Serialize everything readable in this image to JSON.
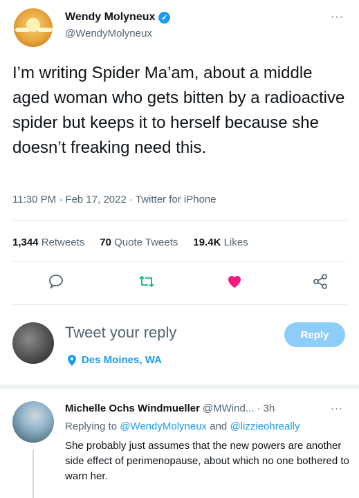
{
  "tweet": {
    "author_name": "Wendy Molyneux",
    "author_handle": "@WendyMolyneux",
    "more": "···",
    "text": "I’m writing Spider Ma’am, about a middle aged woman who gets bitten by a radioactive spider but keeps it to herself because she doesn’t freaking need this.",
    "meta": "11:30 PM · Feb 17, 2022 · Twitter for iPhone",
    "retweets_count": "1,344",
    "retweets_label": "Retweets",
    "quotes_count": "70",
    "quotes_label": "Quote Tweets",
    "likes_count": "19.4K",
    "likes_label": "Likes",
    "icons": [
      "comment-icon",
      "retweet-icon",
      "heart-icon",
      "share-icon"
    ]
  },
  "reply_box": {
    "placeholder": "Tweet your reply",
    "button_label": "Reply",
    "location": "Des Moines, WA"
  },
  "comment": {
    "name": "Michelle Ochs Windmueller",
    "handle": "@MWind...",
    "time": "· 3h",
    "more": "···",
    "replying_prefix": "Replying to",
    "replying_to_1": "@WendyMolyneux",
    "replying_and": "and",
    "replying_to_2": "@lizzieohreally",
    "text": "She probably just assumes that the new powers are another side effect of perimenopause, about which no one bothered to warn her."
  },
  "colors": {
    "accent": "#1d9bf0",
    "like": "#f91880",
    "reply_button": "#8ecdf8",
    "secondary_text": "#536471"
  }
}
